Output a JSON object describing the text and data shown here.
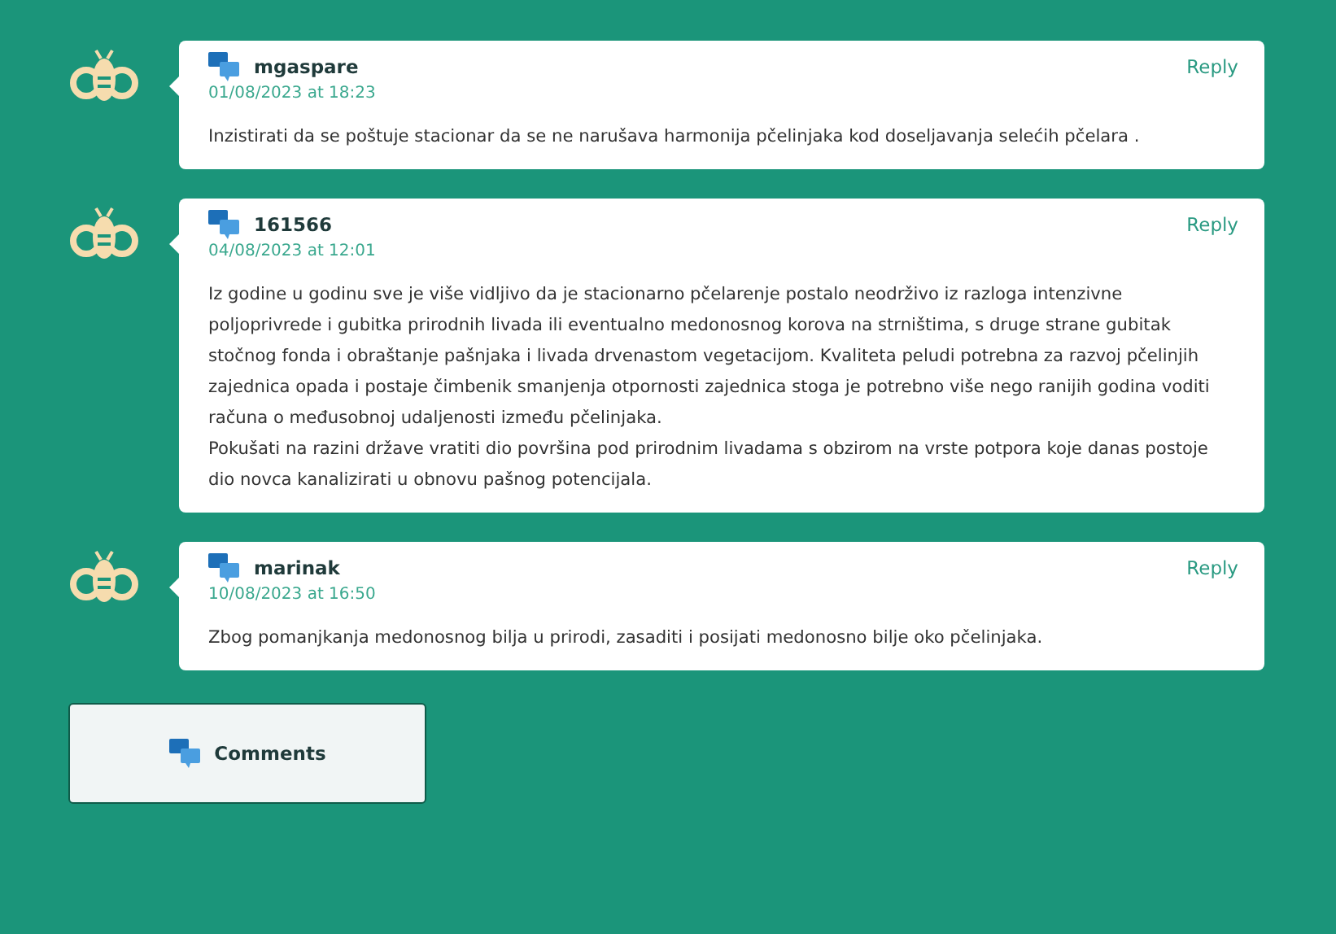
{
  "comments": [
    {
      "author": "mgaspare",
      "date": "01/08/2023 at 18:23",
      "reply": "Reply",
      "paragraphs": [
        "Inzistirati da se poštuje stacionar da se ne narušava harmonija pčelinjaka kod doseljavanja selećih pčelara ."
      ]
    },
    {
      "author": "161566",
      "date": "04/08/2023 at 12:01",
      "reply": "Reply",
      "paragraphs": [
        "Iz godine u godinu sve je više vidljivo da je stacionarno pčelarenje postalo neodrživo iz razloga intenzivne poljoprivrede i gubitka prirodnih livada ili eventualno medonosnog korova na strništima, s druge strane gubitak stočnog fonda i obraštanje pašnjaka i livada drvenastom vegetacijom. Kvaliteta peludi potrebna za razvoj pčelinjih zajednica opada i postaje čimbenik smanjenja otpornosti zajednica stoga je potrebno više nego ranijih godina voditi računa o međusobnoj udaljenosti između pčelinjaka.",
        "Pokušati na razini države vratiti dio površina pod prirodnim livadama s obzirom na vrste potpora koje danas postoje dio novca kanalizirati u obnovu pašnog potencijala."
      ]
    },
    {
      "author": "marinak",
      "date": "10/08/2023 at 16:50",
      "reply": "Reply",
      "paragraphs": [
        "Zbog pomanjkanja medonosnog bilja u prirodi, zasaditi i posijati medonosno bilje oko pčelinjaka."
      ]
    }
  ],
  "comments_button": "Comments"
}
